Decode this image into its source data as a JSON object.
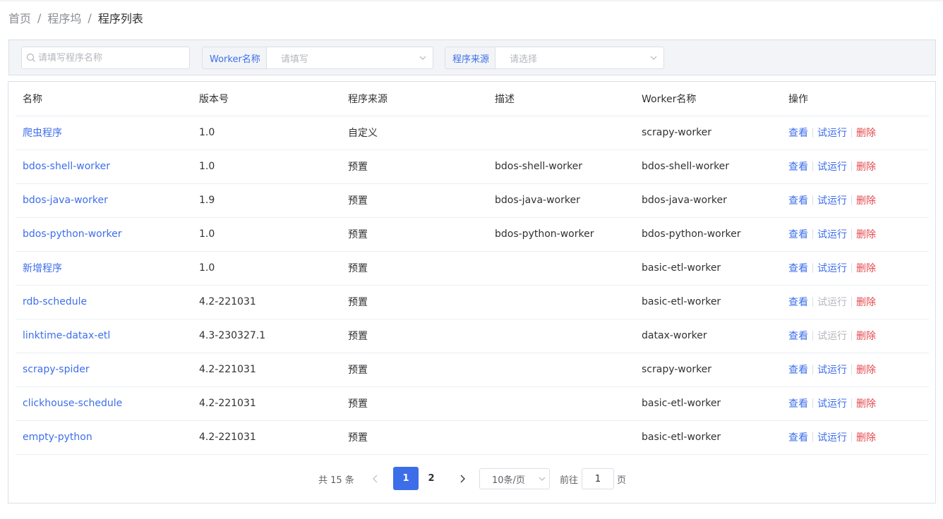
{
  "breadcrumb": [
    "首页",
    "程序坞",
    "程序列表"
  ],
  "breadcrumb_separator": "/",
  "filters": {
    "search_placeholder": "请填写程序名称",
    "worker": {
      "label": "Worker名称",
      "placeholder": "请填写"
    },
    "source": {
      "label": "程序来源",
      "placeholder": "请选择"
    }
  },
  "table": {
    "headers": [
      "名称",
      "版本号",
      "程序来源",
      "描述",
      "Worker名称",
      "操作"
    ],
    "rows": [
      {
        "name": "爬虫程序",
        "version": "1.0",
        "source": "自定义",
        "description": "",
        "worker": "scrapy-worker",
        "run_enabled": true
      },
      {
        "name": "bdos-shell-worker",
        "version": "1.0",
        "source": "预置",
        "description": "bdos-shell-worker",
        "worker": "bdos-shell-worker",
        "run_enabled": true
      },
      {
        "name": "bdos-java-worker",
        "version": "1.9",
        "source": "预置",
        "description": "bdos-java-worker",
        "worker": "bdos-java-worker",
        "run_enabled": true
      },
      {
        "name": "bdos-python-worker",
        "version": "1.0",
        "source": "预置",
        "description": "bdos-python-worker",
        "worker": "bdos-python-worker",
        "run_enabled": true
      },
      {
        "name": "新增程序",
        "version": "1.0",
        "source": "预置",
        "description": "",
        "worker": "basic-etl-worker",
        "run_enabled": true
      },
      {
        "name": "rdb-schedule",
        "version": "4.2-221031",
        "source": "预置",
        "description": "",
        "worker": "basic-etl-worker",
        "run_enabled": false
      },
      {
        "name": "linktime-datax-etl",
        "version": "4.3-230327.1",
        "source": "预置",
        "description": "",
        "worker": "datax-worker",
        "run_enabled": false
      },
      {
        "name": "scrapy-spider",
        "version": "4.2-221031",
        "source": "预置",
        "description": "",
        "worker": "scrapy-worker",
        "run_enabled": true
      },
      {
        "name": "clickhouse-schedule",
        "version": "4.2-221031",
        "source": "预置",
        "description": "",
        "worker": "basic-etl-worker",
        "run_enabled": true
      },
      {
        "name": "empty-python",
        "version": "4.2-221031",
        "source": "预置",
        "description": "",
        "worker": "basic-etl-worker",
        "run_enabled": true
      }
    ],
    "actions": {
      "view": "查看",
      "run": "试运行",
      "delete": "删除"
    }
  },
  "pagination": {
    "total_text": "共 15 条",
    "pages": [
      "1",
      "2"
    ],
    "current_page": "1",
    "page_size": "10条/页",
    "goto_label": "前往",
    "goto_value": "1",
    "goto_suffix": "页"
  },
  "colors": {
    "primary": "#3d6eea",
    "danger": "#e5484d",
    "disabled": "#b4b7bd"
  }
}
